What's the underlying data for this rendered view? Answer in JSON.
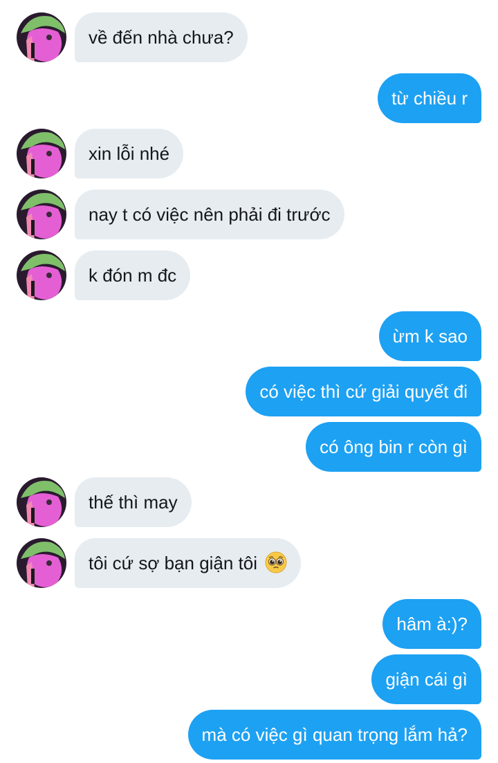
{
  "conversation": {
    "messages": [
      {
        "direction": "in",
        "text": "về đến nhà chưa?"
      },
      {
        "direction": "out",
        "text": "từ chiều r"
      },
      {
        "direction": "in",
        "text": "xin lỗi nhé"
      },
      {
        "direction": "in",
        "text": "nay t có việc nên phải đi trước"
      },
      {
        "direction": "in",
        "text": "k đón m đc"
      },
      {
        "direction": "out",
        "text": "ừm k sao"
      },
      {
        "direction": "out",
        "text": "có việc thì cứ giải quyết đi"
      },
      {
        "direction": "out",
        "text": "có ông bin r còn gì"
      },
      {
        "direction": "in",
        "text": "thế thì may"
      },
      {
        "direction": "in",
        "text": "tôi cứ sợ bạn giận tôi",
        "emoji": "pleading-face-emoji"
      },
      {
        "direction": "out",
        "text": "hâm à:)?"
      },
      {
        "direction": "out",
        "text": "giận cái gì"
      },
      {
        "direction": "out",
        "text": "mà có việc gì quan trọng lắm hả?"
      }
    ]
  },
  "theme": {
    "incoming_bubble": "#e6ecf0",
    "outgoing_bubble": "#1da1f2",
    "incoming_text": "#14171a",
    "outgoing_text": "#ffffff"
  },
  "avatar": {
    "icon": "user-avatar",
    "hair_color": "#7fbf6a",
    "face_color": "#e45fd3"
  }
}
